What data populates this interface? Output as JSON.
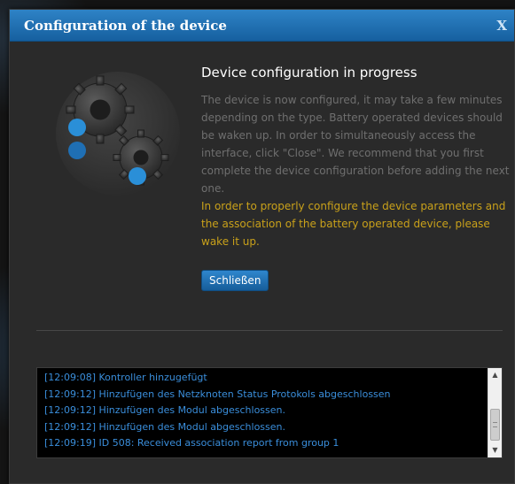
{
  "dialog": {
    "title": "Configuration of the device",
    "close_glyph": "X"
  },
  "content": {
    "heading": "Device configuration in progress",
    "info_text": "The device is now configured, it may take a few minutes depending on the type. Battery operated devices should be waken up. In order to simultaneously access the interface, click \"Close\". We recommend that you first complete the device configuration before adding the next one.",
    "warning_text": "In order to properly configure the device parameters and the association of the battery operated device, please wake it up.",
    "close_button_label": "Schließen"
  },
  "illustration": {
    "icon": "gears-icon"
  },
  "log": {
    "lines": [
      "[12:09:08] Kontroller hinzugefügt",
      "[12:09:12] Hinzufügen des Netzknoten Status Protokols abgeschlossen",
      "[12:09:12] Hinzufügen des Modul abgeschlossen.",
      "[12:09:12] Hinzufügen des Modul abgeschlossen.",
      "[12:09:19] ID 508: Received association report from group 1"
    ]
  },
  "colors": {
    "titlebar": "#1f72b5",
    "info_text": "#6f6f6f",
    "warning_text": "#c9a11a",
    "log_text": "#3a8edb",
    "accent_dot": "#2a8fd8"
  }
}
